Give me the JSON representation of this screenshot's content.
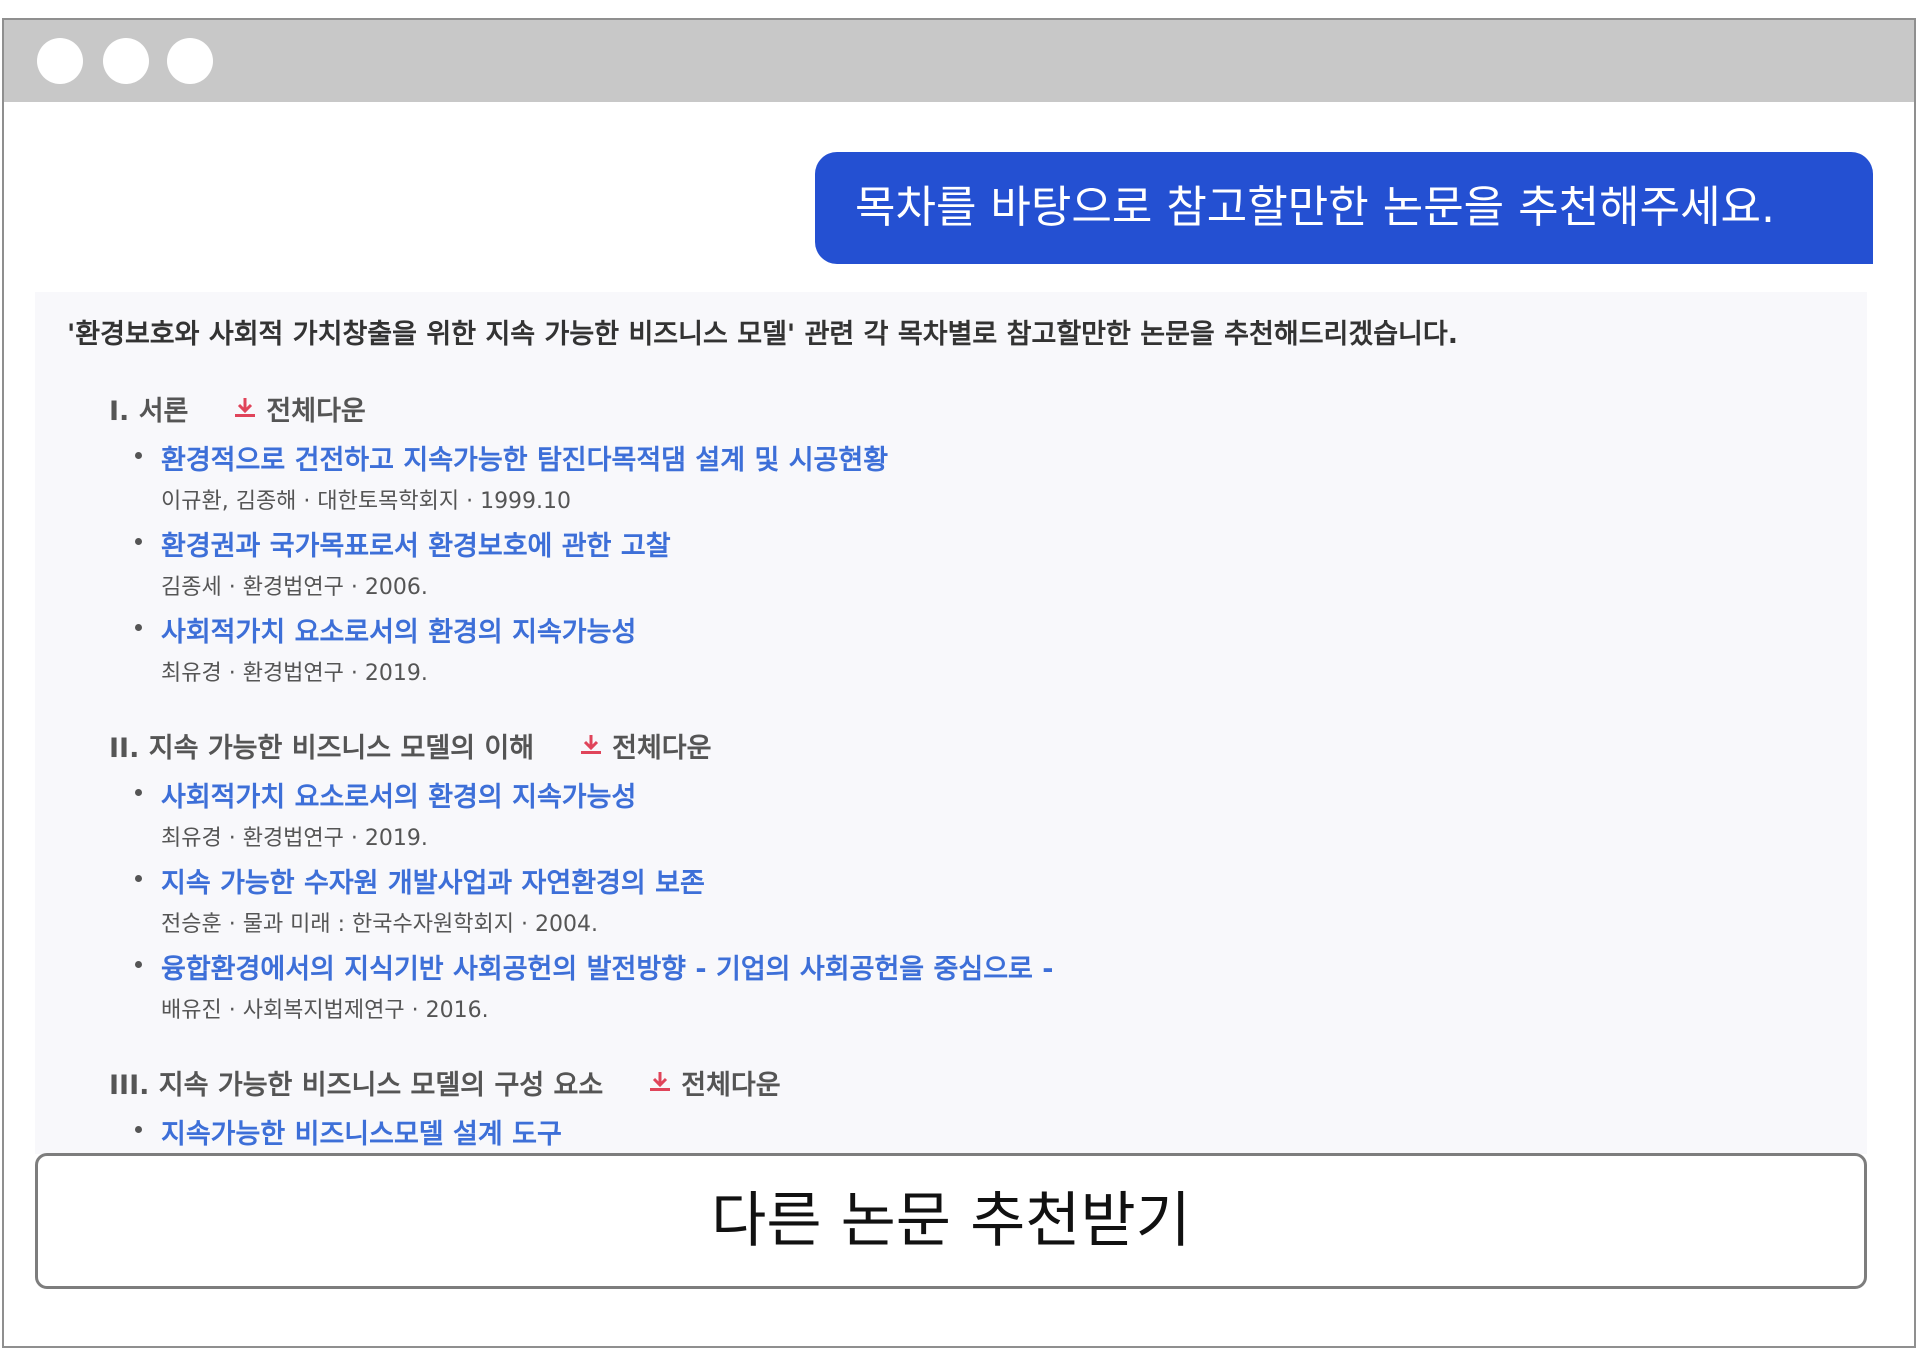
{
  "user_message": "목차를 바탕으로 참고할만한 논문을 추천해주세요.",
  "reply": {
    "intro": "'환경보호와 사회적 가치창출을 위한 지속 가능한 비즈니스 모델' 관련 각 목차별로 참고할만한 논문을 추천해드리겠습니다.",
    "sections": [
      {
        "title": "I. 서론",
        "download_label": "전체다운",
        "papers": [
          {
            "title": "환경적으로 건전하고 지속가능한 탐진다목적댐 설계 및 시공현황",
            "meta": "이규환, 김종해 · 대한토목학회지 · 1999.10"
          },
          {
            "title": "환경권과 국가목표로서 환경보호에 관한 고찰",
            "meta": "김종세 · 환경법연구 · 2006."
          },
          {
            "title": "사회적가치 요소로서의 환경의 지속가능성",
            "meta": "최유경 · 환경법연구 · 2019."
          }
        ]
      },
      {
        "title": "II. 지속 가능한 비즈니스 모델의 이해",
        "download_label": "전체다운",
        "papers": [
          {
            "title": "사회적가치 요소로서의 환경의 지속가능성",
            "meta": "최유경 · 환경법연구 · 2019."
          },
          {
            "title": "지속 가능한 수자원 개발사업과 자연환경의 보존",
            "meta": "전승훈 · 물과 미래 : 한국수자원학회지 · 2004."
          },
          {
            "title": "융합환경에서의 지식기반 사회공헌의 발전방향 - 기업의 사회공헌을 중심으로 -",
            "meta": "배유진 · 사회복지법제연구 · 2016."
          }
        ]
      },
      {
        "title": "III. 지속 가능한 비즈니스 모델의 구성 요소",
        "download_label": "전체다운",
        "papers": [
          {
            "title": "지속가능한 비즈니스모델 설계 도구",
            "meta": ""
          }
        ]
      }
    ]
  },
  "more_button_label": "다른 논문 추천받기",
  "colors": {
    "user_bubble": "#2450d2",
    "link": "#3d6fd8",
    "download_icon": "#e0445a",
    "titlebar": "#c8c8c8"
  },
  "icons": {
    "download": "download-icon"
  }
}
